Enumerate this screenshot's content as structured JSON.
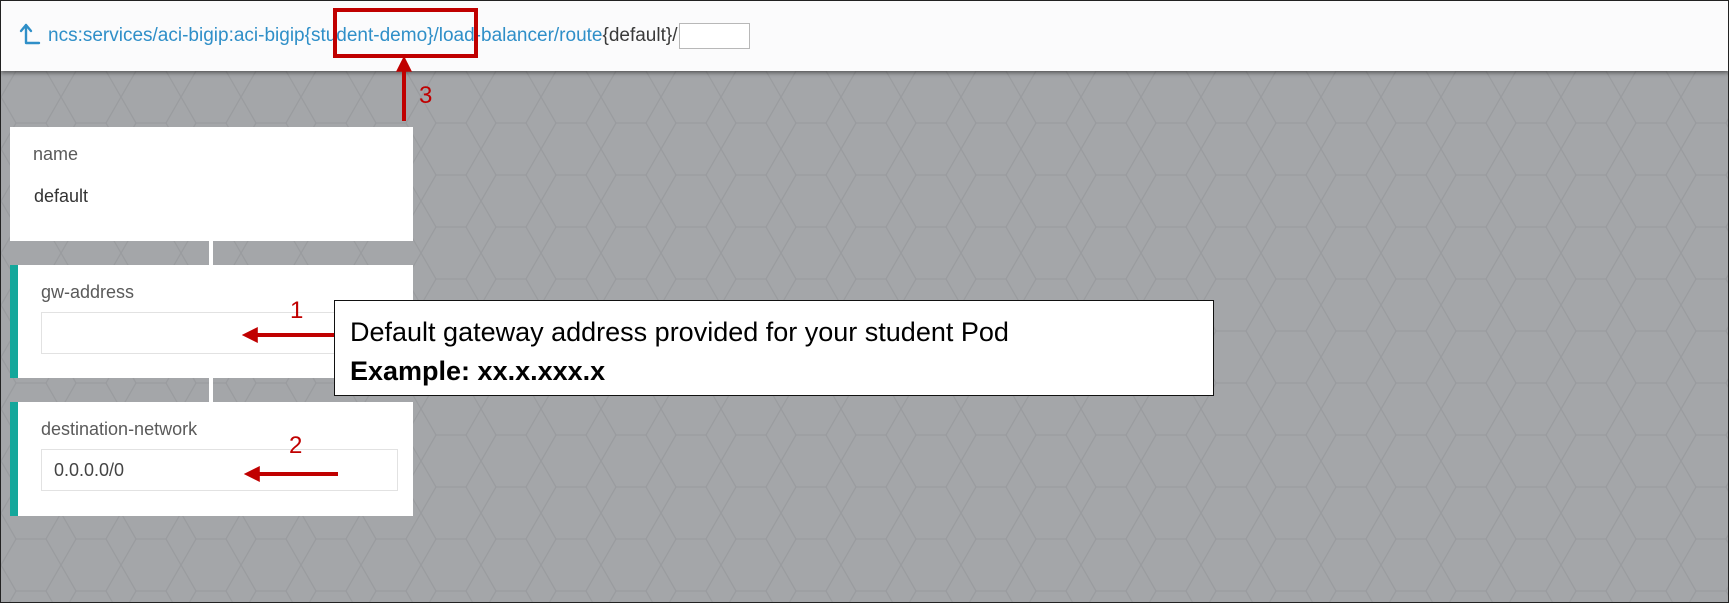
{
  "breadcrumb": {
    "segments": [
      {
        "text": "ncs:services/aci-bigip:aci-bigip",
        "type": "link"
      },
      {
        "text": "{student-demo}",
        "type": "link"
      },
      {
        "text": "/load-balancer/route",
        "type": "link"
      },
      {
        "text": "{default}/",
        "type": "plain"
      }
    ],
    "key_input_value": ""
  },
  "form": {
    "name": {
      "label": "name",
      "value": "default"
    },
    "gw_address": {
      "label": "gw-address",
      "value": ""
    },
    "destination_network": {
      "label": "destination-network",
      "value": "0.0.0.0/0"
    }
  },
  "annotations": {
    "callout_line1": "Default gateway address provided for your student Pod",
    "callout_line2": "Example: xx.x.xxx.x",
    "markers": [
      "1",
      "2",
      "3"
    ]
  },
  "colors": {
    "link": "#2f8fc8",
    "accent": "#14a79b",
    "annotation_red": "#c00000",
    "background": "#a4a6a9"
  },
  "icons": {
    "up": "arrow-up-icon"
  }
}
